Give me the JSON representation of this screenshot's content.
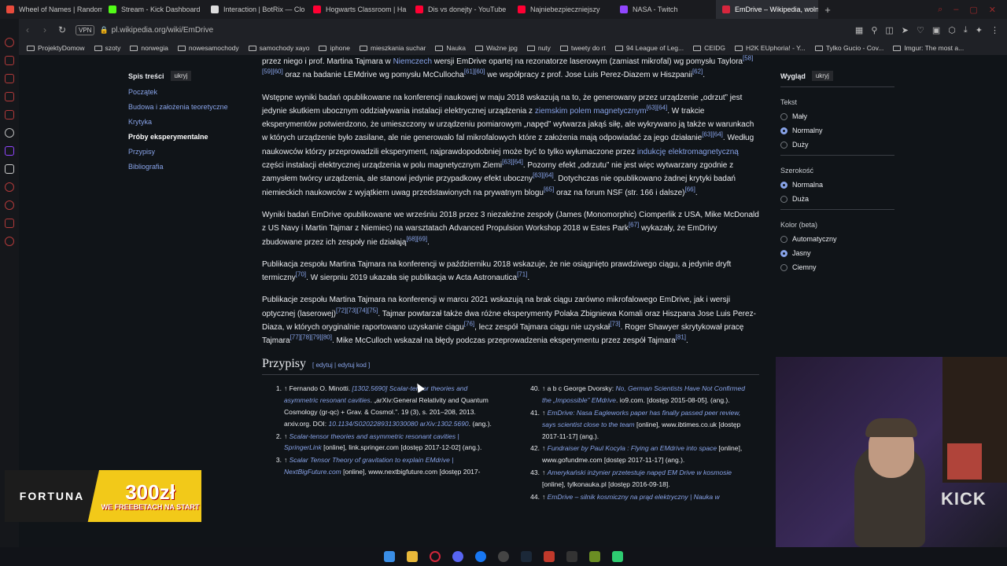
{
  "tabs": [
    {
      "label": "Wheel of Names | Random",
      "color": "#e94b3c"
    },
    {
      "label": "Stream - Kick Dashboard",
      "color": "#53fc18"
    },
    {
      "label": "Interaction | BotRix — Clo",
      "color": "#dddddd"
    },
    {
      "label": "Hogwarts Classroom | Ha",
      "color": "#ff0033"
    },
    {
      "label": "Dis vs donejty - YouTube",
      "color": "#ff0033"
    },
    {
      "label": "Najniebezpieczniejszy",
      "color": "#ff0033"
    },
    {
      "label": "NASA - Twitch",
      "color": "#9146ff"
    },
    {
      "label": "EmDrive – Wikipedia, woln",
      "color": "#d7263d"
    }
  ],
  "tab_add": "+",
  "address": {
    "vpn": "VPN",
    "url": "pl.wikipedia.org/wiki/EmDrive"
  },
  "bookmarks": [
    "ProjektyDomow",
    "szoty",
    "norwegia",
    "nowesamochody",
    "samochody xayo",
    "iphone",
    "mieszkania suchar",
    "Nauka",
    "Ważne jpg",
    "nuty",
    "tweety do rt",
    "94 League of Leg...",
    "CEIDG",
    "H2K EUphoria! - Y...",
    "Tylko Gucio - Cov...",
    "Imgur: The most a..."
  ],
  "toc": {
    "title": "Spis treści",
    "hide": "ukryj",
    "items": [
      "Początek",
      "Budowa i założenia teoretyczne",
      "Krytyka",
      "Próby eksperymentalne",
      "Przypisy",
      "Bibliografia"
    ]
  },
  "article": {
    "p0a": "przez niego i prof. Martina Tajmara w ",
    "p0_link": "Niemczech",
    "p0b": " wersji EmDrive opartej na rezonatorze laserowym (zamiast mikrofal) wg pomysłu Taylora",
    "p0_refs": "[58][59][60]",
    "p0c": " oraz na badanie LEMdrive wg pomysłu McCullocha",
    "p0_refs2": "[61][60]",
    "p0d": " we współpracy z prof. Jose Luis Perez-Diazem w Hiszpanii",
    "p0_refs3": "[62]",
    "p0e": ".",
    "p1a": "Wstępne wyniki badań opublikowane na konferencji naukowej w maju 2018 wskazują na to, że generowany przez urządzenie „odrzut” jest jedynie skutkiem ubocznym oddziaływania instalacji elektrycznej urządzenia z ",
    "p1_link": "ziemskim polem magnetycznym",
    "p1_refs": "[63][64]",
    "p1b": ". W trakcie eksperymentów potwierdzono, że umieszczony w urządzeniu pomiarowym „napęd” wytwarza jakąś siłę, ale wykrywano ją także w warunkach w których urządzenie było zasilane, ale nie generowało fal mikrofalowych które z założenia mają odpowiadać za jego działanie",
    "p1_refs2": "[63][64]",
    "p1c": ". Według naukowców którzy przeprowadzili eksperyment, najprawdopodobniej może być to tylko wyłumaczone przez ",
    "p1_link2": "indukcję elektromagnetyczną",
    "p1d": " części instalacji elektrycznej urządzenia w polu magnetycznym Ziemi",
    "p1_refs3": "[63][64]",
    "p1e": ". Pozorny efekt „odrzutu” nie jest więc wytwarzany zgodnie z zamysłem twórcy urządzenia, ale stanowi jedynie przypadkowy efekt uboczny",
    "p1_refs4": "[63][64]",
    "p1f": ". Dotychczas nie opublikowano żadnej krytyki badań niemieckich naukowców z wyjątkiem uwag przedstawionych na prywatnym blogu",
    "p1_refs5": "[65]",
    "p1g": " oraz na forum NSF (str. 166 i dalsze)",
    "p1_refs6": "[66]",
    "p1h": ".",
    "p2a": "Wyniki badań EmDrive opublikowane we wrześniu 2018 przez 3 niezależne zespoły (James (Monomorphic) Ciomperlik z USA, Mike McDonald z US Navy i Martin Tajmar z Niemiec) na warsztatach Advanced Propulsion Workshop 2018 w Estes Park",
    "p2_refs": "[67]",
    "p2b": " wykazały, że EmDrivy zbudowane przez ich zespoły nie działają",
    "p2_refs2": "[68][69]",
    "p2c": ".",
    "p3a": "Publikacja zespołu Martina Tajmara na konferencji w październiku 2018 wskazuje, że nie osiągnięto prawdziwego ciągu, a jedynie dryft termiczny",
    "p3_refs": "[70]",
    "p3b": ". W sierpniu 2019 ukazała się publikacja w Acta Astronautica",
    "p3_refs2": "[71]",
    "p3c": ".",
    "p4a": "Publikacje zespołu Martina Tajmara na konferencji w marcu 2021 wskazują na brak ciągu zarówno mikrofalowego EmDrive, jak i wersji optycznej (laserowej)",
    "p4_refs": "[72][73][74][75]",
    "p4b": ". Tajmar powtarzał także dwa różne eksperymenty Polaka Zbigniewa Komali oraz Hiszpana Jose Luis Perez-Diaza, w których oryginalnie raportowano uzyskanie ciągu",
    "p4_refs2": "[76]",
    "p4c": ", lecz zespół Tajmara ciągu nie uzyskał",
    "p4_refs3": "[73]",
    "p4d": ". Roger Shawyer skrytykował pracę Tajmara",
    "p4_refs4": "[77][78][79][80]",
    "p4e": ". Mike McCulloch wskazał na błędy podczas przeprowadzenia eksperymentu przez zespół Tajmara",
    "p4_refs5": "[81]",
    "p4f": "."
  },
  "przypisy": {
    "title": "Przypisy",
    "edit": "[ edytuj | edytuj kod ]"
  },
  "refs_left": [
    {
      "n": "1.",
      "parts": [
        "↑ Fernando O. Minotti. ",
        "[1302.5690] Scalar-tensor theories and asymmetric resonant cavities",
        ". „arXiv:General Relativity and Quantum Cosmology (gr-qc) + Grav. & Cosmol.”. 19 (3), s. 201–208, 2013. arxiv.org. DOI: ",
        "10.1134/S0202289313030080",
        " ",
        "arXiv:1302.5690",
        ". (ang.)."
      ]
    },
    {
      "n": "2.",
      "parts": [
        "↑ ",
        "Scalar-tensor theories and asymmetric resonant cavities | SpringerLink",
        " [online], link.springer.com [dostęp 2017-12-02] (ang.)."
      ]
    },
    {
      "n": "3.",
      "parts": [
        "↑ ",
        "Scalar Tensor Theory of gravitation to explain EMdrive | NextBigFuture.com",
        " [online], www.nextbigfuture.com [dostęp 2017-"
      ]
    }
  ],
  "refs_right": [
    {
      "n": "40.",
      "parts": [
        "↑ a b c George Dvorsky: ",
        "No, German Scientists Have Not Confirmed the „Impossible” EMdrive",
        ". io9.com. [dostęp 2015-08-05]. (ang.)."
      ]
    },
    {
      "n": "41.",
      "parts": [
        "↑ ",
        "EmDrive: Nasa Eagleworks paper has finally passed peer review, says scientist close to the team",
        " [online], www.ibtimes.co.uk [dostęp 2017-11-17] (ang.)."
      ]
    },
    {
      "n": "42.",
      "parts": [
        "↑ ",
        "Fundraiser by Paul Kocyla : Flying an EMdrive into space",
        " [online], www.gofundme.com [dostęp 2017-11-17] (ang.)."
      ]
    },
    {
      "n": "43.",
      "parts": [
        "↑ ",
        "Amerykański inżynier przetestuje napęd EM Drive w kosmosie",
        " [online], tylkonauka.pl [dostęp 2016-09-18]."
      ]
    },
    {
      "n": "44.",
      "parts": [
        "↑ ",
        "EmDrive – silnik kosmiczny na prąd elektryczny | Nauka w",
        ""
      ]
    }
  ],
  "appearance": {
    "title": "Wygląd",
    "hide": "ukryj",
    "text_label": "Tekst",
    "text_opts": [
      "Mały",
      "Normalny",
      "Duży"
    ],
    "text_selected": 1,
    "width_label": "Szerokość",
    "width_opts": [
      "Normalna",
      "Duża"
    ],
    "width_selected": 0,
    "color_label": "Kolor (beta)",
    "color_opts": [
      "Automatyczny",
      "Jasny",
      "Ciemny"
    ],
    "color_selected": 1
  },
  "overlay_ad": {
    "brand": "FORTUNA",
    "amount": "300zł",
    "sub": "WE FREEBETACH NA START"
  },
  "webcam": {
    "brand": "KICK"
  }
}
